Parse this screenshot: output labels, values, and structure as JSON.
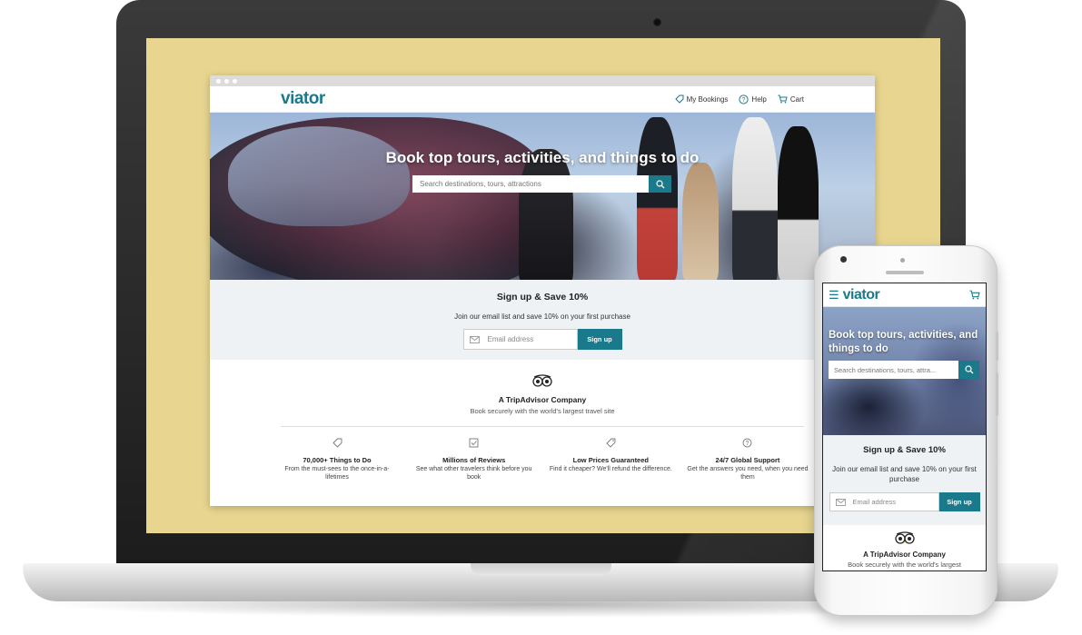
{
  "desktop": {
    "logo": "viator",
    "nav": [
      {
        "label": "My Bookings",
        "icon": "tag-icon"
      },
      {
        "label": "Help",
        "icon": "help-circle-icon"
      },
      {
        "label": "Cart",
        "icon": "cart-icon"
      }
    ],
    "hero": {
      "title": "Book top tours, activities, and things to do",
      "search_placeholder": "Search destinations, tours, attractions"
    },
    "signup": {
      "title": "Sign up & Save 10%",
      "subtitle": "Join our email list and save 10% on your first purchase",
      "email_placeholder": "Email address",
      "button": "Sign up"
    },
    "tripadvisor": {
      "title": "A TripAdvisor Company",
      "subtitle": "Book securely with the world's largest travel site"
    },
    "features": [
      {
        "icon": "tag-icon",
        "title": "70,000+ Things to Do",
        "desc": "From the must-sees to the once-in-a-lifetimes"
      },
      {
        "icon": "checkbox-icon",
        "title": "Millions of Reviews",
        "desc": "See what other travelers think before you book"
      },
      {
        "icon": "price-tag-icon",
        "title": "Low Prices Guaranteed",
        "desc": "Find it cheaper? We'll refund the difference."
      },
      {
        "icon": "help-circle-icon",
        "title": "24/7 Global Support",
        "desc": "Get the answers you need, when you need them"
      }
    ]
  },
  "mobile": {
    "logo": "viator",
    "hero": {
      "title": "Book top tours, activities, and things to do",
      "search_placeholder": "Search destinations, tours, attra..."
    },
    "signup": {
      "title": "Sign up & Save 10%",
      "subtitle": "Join our email list and save 10% on your first purchase",
      "email_placeholder": "Email address",
      "button": "Sign up"
    },
    "tripadvisor": {
      "title": "A TripAdvisor Company",
      "subtitle": "Book securely with the world's largest travel site"
    }
  },
  "colors": {
    "brand": "#1a7a8c",
    "screen_wallpaper": "#e8d690",
    "signup_bg": "#eef2f5"
  }
}
